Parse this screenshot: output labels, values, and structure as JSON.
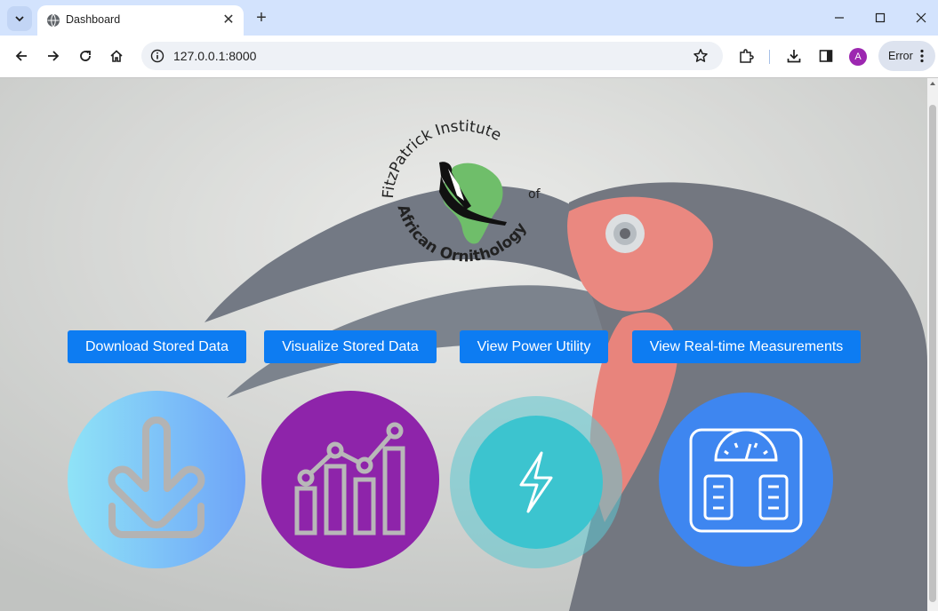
{
  "browser": {
    "tab_title": "Dashboard",
    "url": "127.0.0.1:8000",
    "profile_initial": "A",
    "status_chip": "Error"
  },
  "page": {
    "logo": {
      "text_top": "FitzPatrick Institute",
      "text_of": "of",
      "text_bottom": "African Ornithology"
    },
    "buttons": [
      {
        "label": "Download Stored Data"
      },
      {
        "label": "Visualize Stored Data"
      },
      {
        "label": "View Power Utility"
      },
      {
        "label": "View Real-time Measurements"
      }
    ],
    "tiles": [
      {
        "icon": "download-tray-icon",
        "color_start": "#8fe3f7",
        "color_end": "#6ea4f8"
      },
      {
        "icon": "bar-line-chart-icon",
        "color": "#8e24aa"
      },
      {
        "icon": "lightning-bolt-icon",
        "color": "#3cc4cf"
      },
      {
        "icon": "weighing-scale-icon",
        "color": "#3e86f0"
      }
    ]
  }
}
